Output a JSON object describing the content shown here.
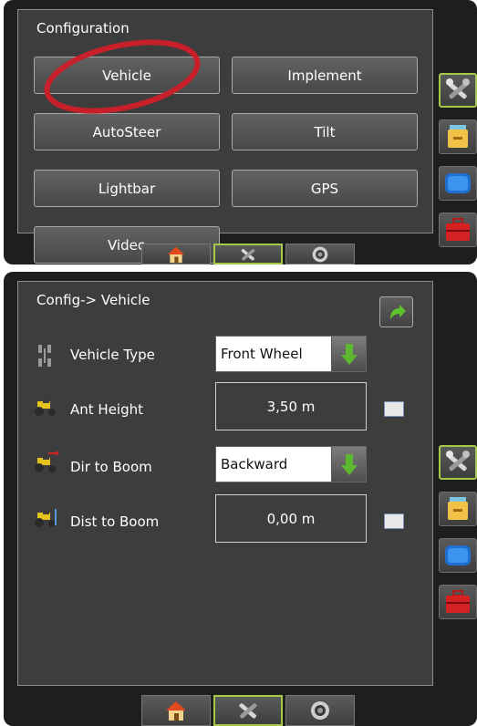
{
  "top": {
    "title": "Configuration",
    "buttons": {
      "vehicle": "Vehicle",
      "implement": "Implement",
      "autosteer": "AutoSteer",
      "tilt": "Tilt",
      "lightbar": "Lightbar",
      "gps": "GPS",
      "video": "Video"
    },
    "highlight_color": "#c8202a"
  },
  "bottom": {
    "title": "Config-> Vehicle",
    "rows": [
      {
        "label": "Vehicle Type",
        "value": "Front Wheel",
        "control": "dropdown"
      },
      {
        "label": "Ant Height",
        "value": "3,50 m",
        "control": "keypad"
      },
      {
        "label": "Dir to Boom",
        "value": "Backward",
        "control": "dropdown"
      },
      {
        "label": "Dist to Boom",
        "value": "0,00 m",
        "control": "keypad"
      }
    ]
  },
  "sidebar_icons": [
    "tools-icon",
    "folder-icon",
    "console-icon",
    "toolbox-icon"
  ],
  "tabs": [
    "home-icon",
    "tools-icon",
    "camera-icon"
  ],
  "active_tab": "tools-icon",
  "accent_color": "#a8c84a",
  "dropdown_arrow_color": "#5cb82e"
}
